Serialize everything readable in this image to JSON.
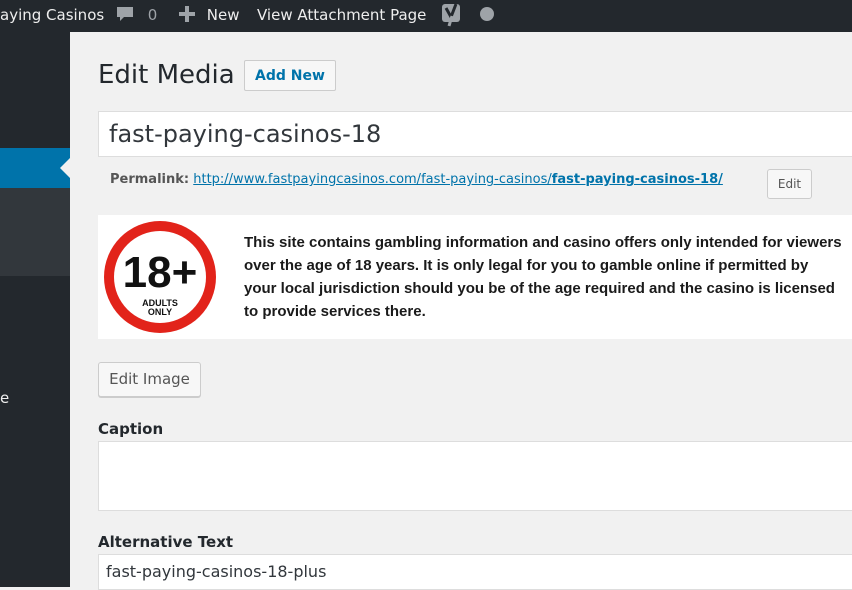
{
  "admin_bar": {
    "site_name": "aying Casinos",
    "comments_count": "0",
    "new_label": "New",
    "view_attachment": "View Attachment Page"
  },
  "sidebar": {
    "cut_label": "e"
  },
  "page": {
    "title": "Edit Media",
    "add_new": "Add New"
  },
  "media": {
    "title_value": "fast-paying-casinos-18",
    "permalink_label": "Permalink:",
    "permalink_base": "http://www.fastpayingcasinos.com/fast-paying-casinos/",
    "permalink_slug": "fast-paying-casinos-18/",
    "edit_permalink": "Edit",
    "image": {
      "badge_number": "18+",
      "badge_line1": "ADULTS",
      "badge_line2": "ONLY",
      "notice_text": "This site contains gambling information and casino offers only intended for viewers over the age of 18 years. It is only legal for you to gamble online if permitted by your local jurisdiction should you be of the age required and the casino is licensed to provide services there."
    },
    "edit_image": "Edit Image",
    "caption_label": "Caption",
    "caption_value": "",
    "alt_label": "Alternative Text",
    "alt_value": "fast-paying-casinos-18-plus"
  },
  "colors": {
    "admin_bar_bg": "#23282d",
    "accent": "#0073aa",
    "badge_red": "#e2231a"
  }
}
